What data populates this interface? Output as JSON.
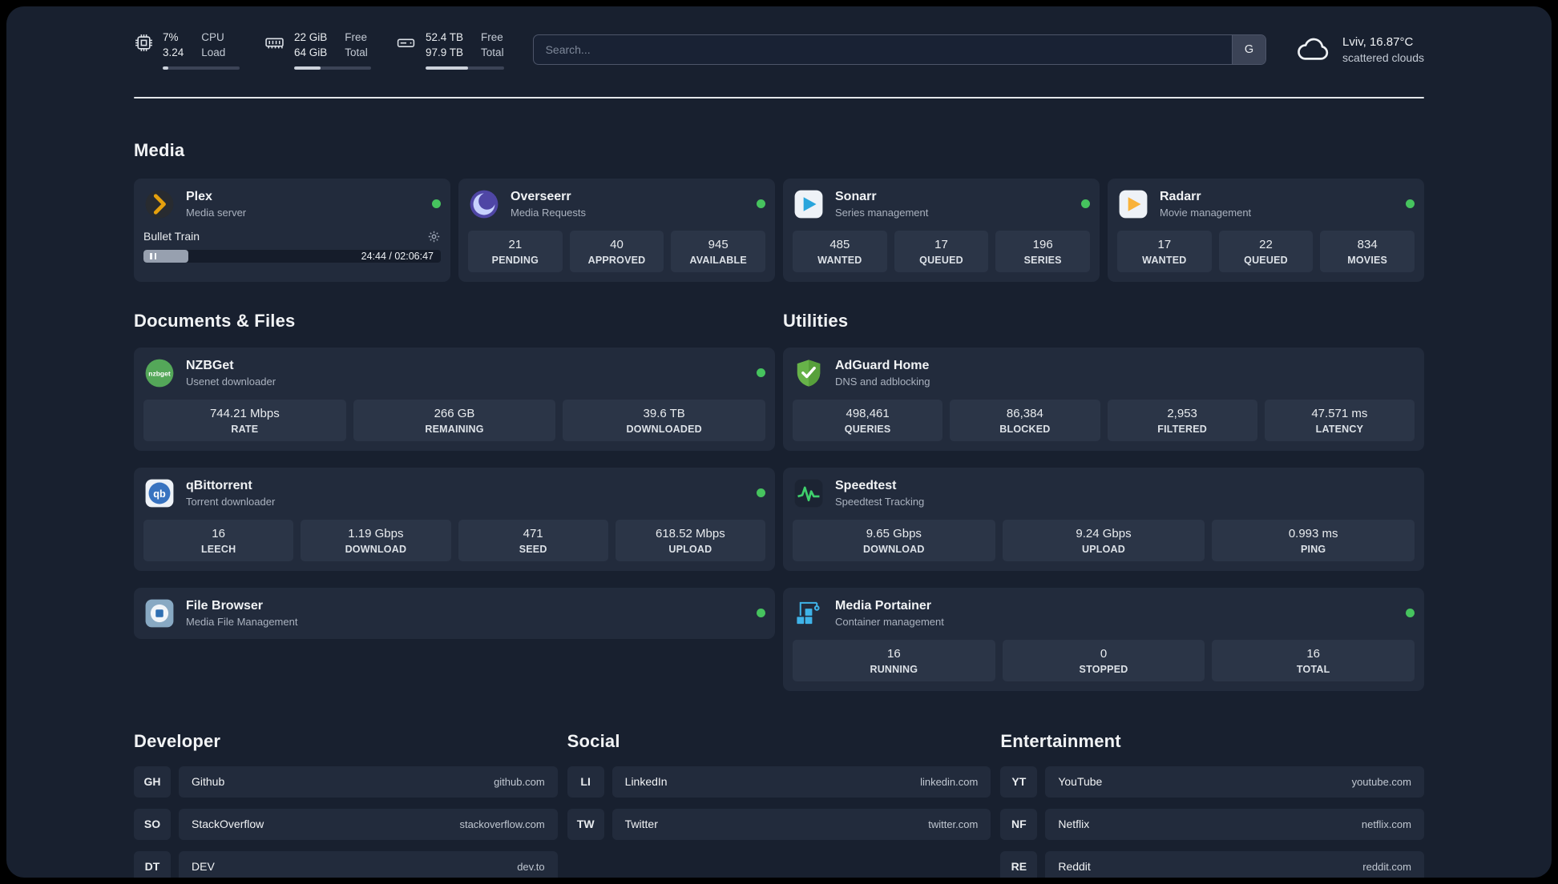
{
  "topbar": {
    "cpu": {
      "usage": "7%",
      "load_avg": "3.24",
      "label1": "CPU",
      "label2": "Load",
      "progress_percent": 7
    },
    "ram": {
      "free": "22 GiB",
      "total": "64 GiB",
      "label1": "Free",
      "label2": "Total",
      "progress_percent": 34
    },
    "disk": {
      "free": "52.4 TB",
      "total": "97.9 TB",
      "label1": "Free",
      "label2": "Total",
      "progress_percent": 54
    },
    "search": {
      "placeholder": "Search...",
      "engine_button": "G"
    },
    "weather": {
      "location": "Lviv, 16.87°C",
      "condition": "scattered clouds"
    }
  },
  "sections": {
    "media": {
      "title": "Media",
      "apps": [
        {
          "name": "Plex",
          "subtitle": "Media server",
          "status_dot": "green",
          "now_playing": {
            "title": "Bullet Train",
            "time": "24:44 / 02:06:47",
            "progress_percent": 15
          }
        },
        {
          "name": "Overseerr",
          "subtitle": "Media Requests",
          "status_dot": "green",
          "stats": [
            {
              "value": "21",
              "label": "PENDING"
            },
            {
              "value": "40",
              "label": "APPROVED"
            },
            {
              "value": "945",
              "label": "AVAILABLE"
            }
          ]
        },
        {
          "name": "Sonarr",
          "subtitle": "Series management",
          "status_dot": "green",
          "stats": [
            {
              "value": "485",
              "label": "WANTED"
            },
            {
              "value": "17",
              "label": "QUEUED"
            },
            {
              "value": "196",
              "label": "SERIES"
            }
          ]
        },
        {
          "name": "Radarr",
          "subtitle": "Movie management",
          "status_dot": "green",
          "stats": [
            {
              "value": "17",
              "label": "WANTED"
            },
            {
              "value": "22",
              "label": "QUEUED"
            },
            {
              "value": "834",
              "label": "MOVIES"
            }
          ]
        }
      ]
    },
    "documents": {
      "title": "Documents & Files",
      "apps": [
        {
          "name": "NZBGet",
          "subtitle": "Usenet downloader",
          "status_dot": "green",
          "stats": [
            {
              "value": "744.21 Mbps",
              "label": "RATE"
            },
            {
              "value": "266 GB",
              "label": "REMAINING"
            },
            {
              "value": "39.6 TB",
              "label": "DOWNLOADED"
            }
          ]
        },
        {
          "name": "qBittorrent",
          "subtitle": "Torrent downloader",
          "status_dot": "green",
          "stats": [
            {
              "value": "16",
              "label": "LEECH"
            },
            {
              "value": "1.19 Gbps",
              "label": "DOWNLOAD"
            },
            {
              "value": "471",
              "label": "SEED"
            },
            {
              "value": "618.52 Mbps",
              "label": "UPLOAD"
            }
          ]
        },
        {
          "name": "File Browser",
          "subtitle": "Media File Management",
          "status_dot": "green",
          "stats": []
        }
      ]
    },
    "utilities": {
      "title": "Utilities",
      "apps": [
        {
          "name": "AdGuard Home",
          "subtitle": "DNS and adblocking",
          "stats": [
            {
              "value": "498,461",
              "label": "QUERIES"
            },
            {
              "value": "86,384",
              "label": "BLOCKED"
            },
            {
              "value": "2,953",
              "label": "FILTERED"
            },
            {
              "value": "47.571 ms",
              "label": "LATENCY"
            }
          ]
        },
        {
          "name": "Speedtest",
          "subtitle": "Speedtest Tracking",
          "stats": [
            {
              "value": "9.65 Gbps",
              "label": "DOWNLOAD"
            },
            {
              "value": "9.24 Gbps",
              "label": "UPLOAD"
            },
            {
              "value": "0.993 ms",
              "label": "PING"
            }
          ]
        },
        {
          "name": "Media Portainer",
          "subtitle": "Container management",
          "status_dot": "green",
          "stats": [
            {
              "value": "16",
              "label": "RUNNING"
            },
            {
              "value": "0",
              "label": "STOPPED"
            },
            {
              "value": "16",
              "label": "TOTAL"
            }
          ]
        }
      ]
    },
    "developer": {
      "title": "Developer",
      "bookmarks": [
        {
          "abbr": "GH",
          "name": "Github",
          "url": "github.com"
        },
        {
          "abbr": "SO",
          "name": "StackOverflow",
          "url": "stackoverflow.com"
        },
        {
          "abbr": "DT",
          "name": "DEV",
          "url": "dev.to"
        }
      ]
    },
    "social": {
      "title": "Social",
      "bookmarks": [
        {
          "abbr": "LI",
          "name": "LinkedIn",
          "url": "linkedin.com"
        },
        {
          "abbr": "TW",
          "name": "Twitter",
          "url": "twitter.com"
        }
      ]
    },
    "entertainment": {
      "title": "Entertainment",
      "bookmarks": [
        {
          "abbr": "YT",
          "name": "YouTube",
          "url": "youtube.com"
        },
        {
          "abbr": "NF",
          "name": "Netflix",
          "url": "netflix.com"
        },
        {
          "abbr": "RE",
          "name": "Reddit",
          "url": "reddit.com"
        }
      ]
    }
  },
  "colors": {
    "background": "#18202f",
    "card": "#222b3c",
    "stat_tile": "#2b3547",
    "status_online": "#46c35e",
    "plex_accent": "#e5a00d",
    "sonarr_blue": "#29a5dc",
    "radarr_orange": "#f9b23a",
    "adguard_green": "#67b349",
    "speedtest_green": "#3fd06c",
    "portainer_blue": "#3fb3e8",
    "overseerr_purple": "#4f46a5",
    "nzbget_green": "#54a759",
    "qbittorrent_blue": "#3873c0"
  }
}
